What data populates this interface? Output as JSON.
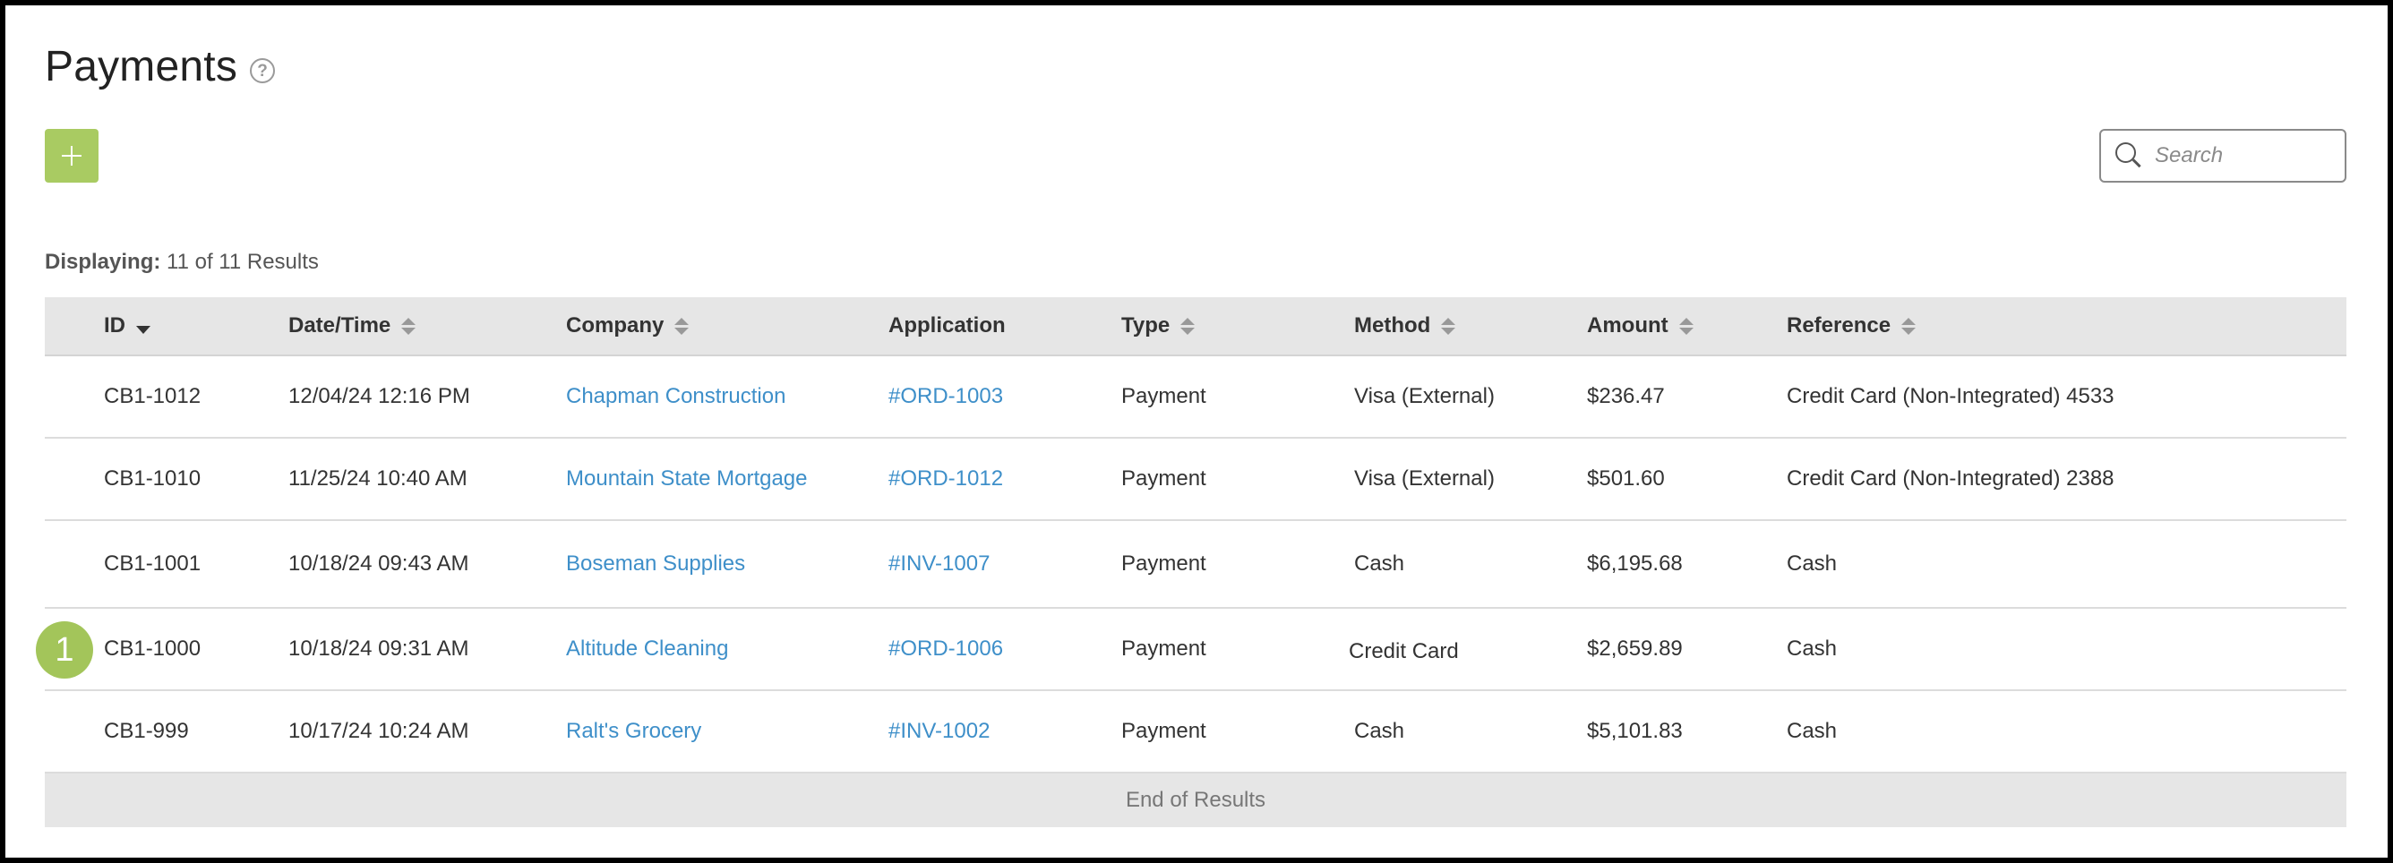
{
  "header": {
    "title": "Payments"
  },
  "toolbar": {
    "search_placeholder": "Search"
  },
  "results": {
    "label": "Displaying:",
    "text": "11 of 11 Results"
  },
  "table": {
    "columns": [
      "ID",
      "Date/Time",
      "Company",
      "Application",
      "Type",
      "Method",
      "Amount",
      "Reference"
    ],
    "rows": [
      {
        "id": "CB1-1012",
        "datetime": "12/04/24 12:16 PM",
        "company": "Chapman Construction",
        "application": "#ORD-1003",
        "type": "Payment",
        "method": "Visa (External)",
        "amount": "$236.47",
        "reference": "Credit Card (Non-Integrated) 4533"
      },
      {
        "id": "CB1-1010",
        "datetime": "11/25/24 10:40 AM",
        "company": "Mountain State Mortgage",
        "application": "#ORD-1012",
        "type": "Payment",
        "method": "Visa (External)",
        "amount": "$501.60",
        "reference": "Credit Card (Non-Integrated) 2388"
      },
      {
        "id": "CB1-1001",
        "datetime": "10/18/24 09:43 AM",
        "company": "Boseman Supplies",
        "application": "#INV-1007",
        "type": "Payment",
        "method": "Cash",
        "amount": "$6,195.68",
        "reference": "Cash"
      },
      {
        "id": "CB1-1000",
        "datetime": "10/18/24 09:31 AM",
        "company": "Altitude Cleaning",
        "application": "#ORD-1006",
        "type": "Payment",
        "method": "Credit Card",
        "amount": "$2,659.89",
        "reference": "Cash"
      },
      {
        "id": "CB1-999",
        "datetime": "10/17/24 10:24 AM",
        "company": "Ralt's Grocery",
        "application": "#INV-1002",
        "type": "Payment",
        "method": "Cash",
        "amount": "$5,101.83",
        "reference": "Cash"
      }
    ],
    "footer": "End of Results"
  },
  "annotation": {
    "badge": "1"
  },
  "colors": {
    "accent": "#a9cb62",
    "link": "#3e8fc9",
    "header_bg": "#e6e6e6"
  },
  "icons": {
    "help": "help-circle-icon",
    "add": "plus-icon",
    "search": "search-icon",
    "sort": "sort-icon"
  }
}
